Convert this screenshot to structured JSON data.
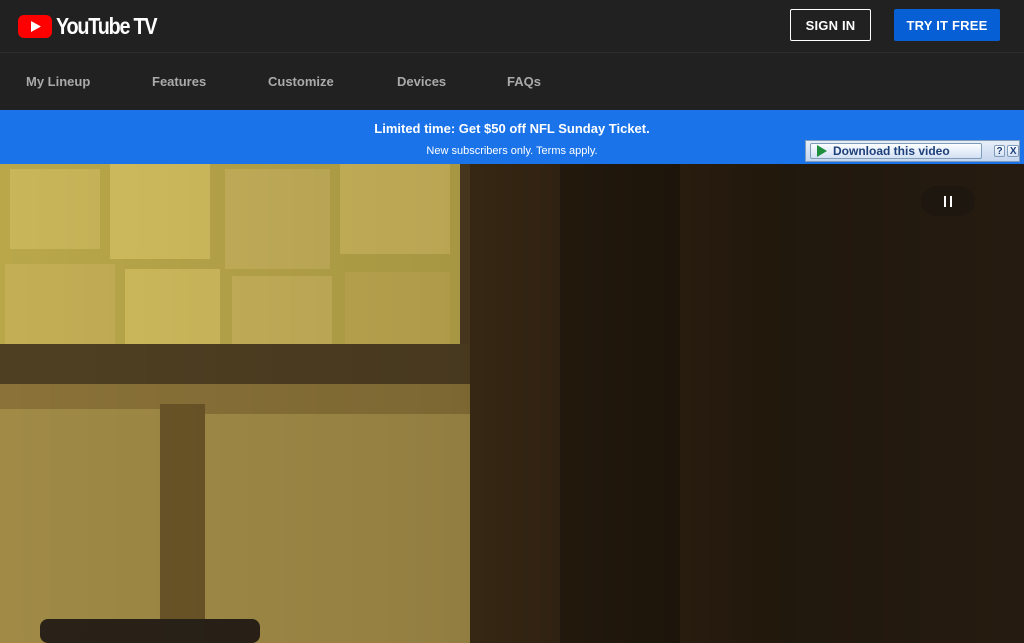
{
  "header": {
    "logo_text": "YouTube TV",
    "sign_in_label": "SIGN IN",
    "try_free_label": "TRY IT FREE"
  },
  "nav": {
    "items": [
      {
        "label": "My Lineup"
      },
      {
        "label": "Features"
      },
      {
        "label": "Customize"
      },
      {
        "label": "Devices"
      },
      {
        "label": "FAQs"
      }
    ]
  },
  "banner": {
    "title": "Limited time: Get $50 off NFL Sunday Ticket.",
    "subtitle": "New subscribers only. Terms apply."
  },
  "download_bar": {
    "label": "Download this video",
    "help_glyph": "?",
    "close_glyph": "X"
  },
  "hero": {
    "pause_icon": "pause-icon"
  },
  "colors": {
    "accent_blue": "#065fd4",
    "banner_blue": "#1a73e8",
    "header_bg": "#212121",
    "logo_red": "#ff0000"
  }
}
